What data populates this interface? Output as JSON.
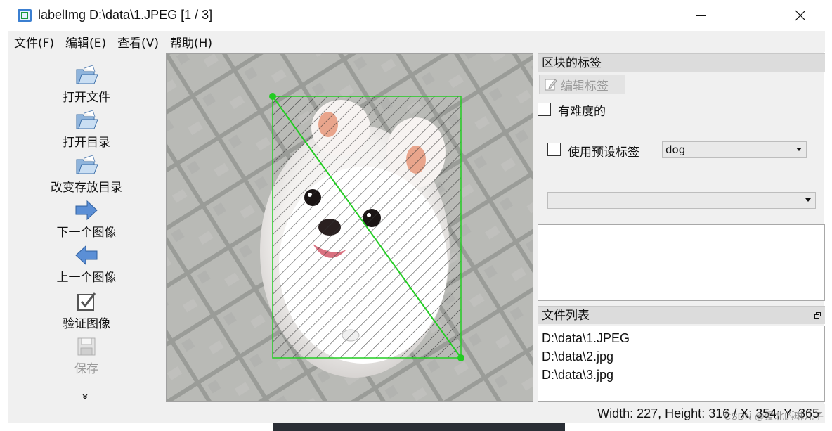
{
  "window": {
    "title": "labelImg D:\\data\\1.JPEG [1 / 3]"
  },
  "menu": [
    {
      "label": "文件(F)"
    },
    {
      "label": "编辑(E)"
    },
    {
      "label": "查看(V)"
    },
    {
      "label": "帮助(H)"
    }
  ],
  "toolbar": {
    "open_file": "打开文件",
    "open_dir": "打开目录",
    "change_save_dir": "改变存放目录",
    "next_image": "下一个图像",
    "prev_image": "上一个图像",
    "verify_image": "验证图像",
    "save": "保存"
  },
  "labels_panel": {
    "title": "区块的标签",
    "edit_label": "编辑标签",
    "difficult": "有难度的",
    "use_default_label": "使用预设标签",
    "default_label_value": "dog",
    "label_filter_value": ""
  },
  "file_panel": {
    "title": "文件列表",
    "files": [
      "D:\\data\\1.JPEG",
      "D:\\data\\2.jpg",
      "D:\\data\\3.jpg"
    ]
  },
  "status": {
    "text": "Width: 227, Height: 316 / X: 354; Y: 365"
  },
  "watermark": "CSDN @爱北的琳儿子",
  "colors": {
    "bbox": "#22cc22",
    "window_bg": "#f0f0f0",
    "dock_header": "#dcdcdc"
  },
  "icons": {
    "app": "labelimg-app-icon",
    "open_file": "folder-open-icon",
    "open_dir": "folder-open-icon",
    "change_save_dir": "folder-open-icon",
    "next_image": "arrow-right-icon",
    "prev_image": "arrow-left-icon",
    "verify_image": "checkbox-verify-icon",
    "save": "floppy-disk-icon",
    "more": "double-chevron-down-icon",
    "edit_label": "edit-pencil-icon",
    "dock_float": "dock-float-icon"
  }
}
